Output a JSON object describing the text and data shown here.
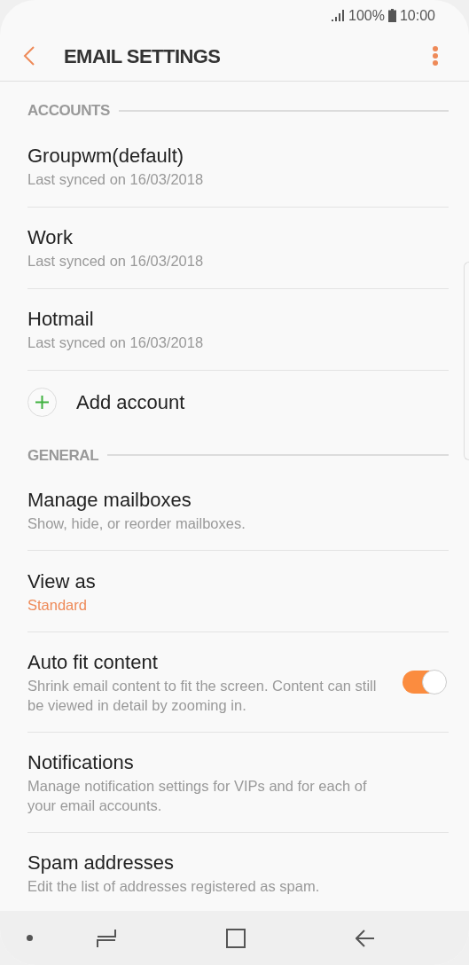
{
  "status_bar": {
    "battery": "100%",
    "time": "10:00"
  },
  "header": {
    "title": "EMAIL SETTINGS"
  },
  "sections": [
    {
      "title": "ACCOUNTS",
      "items": [
        {
          "kind": "account",
          "title": "Groupwm(default)",
          "subtitle": "Last synced on 16/03/2018"
        },
        {
          "kind": "account",
          "title": "Work",
          "subtitle": "Last synced on 16/03/2018"
        },
        {
          "kind": "account",
          "title": "Hotmail",
          "subtitle": "Last synced on 16/03/2018"
        },
        {
          "kind": "add",
          "title": "Add account"
        }
      ]
    },
    {
      "title": "GENERAL",
      "items": [
        {
          "kind": "link",
          "title": "Manage mailboxes",
          "subtitle": "Show, hide, or reorder mailboxes."
        },
        {
          "kind": "value",
          "title": "View as",
          "subtitle": "Standard"
        },
        {
          "kind": "toggle",
          "title": "Auto fit content",
          "subtitle": "Shrink email content to fit the screen. Content can still be viewed in detail by zooming in.",
          "on": true
        },
        {
          "kind": "link",
          "title": "Notifications",
          "subtitle": "Manage notification settings for VIPs and for each of your email accounts."
        },
        {
          "kind": "link",
          "title": "Spam addresses",
          "subtitle": "Edit the list of addresses registered as spam."
        }
      ]
    }
  ]
}
